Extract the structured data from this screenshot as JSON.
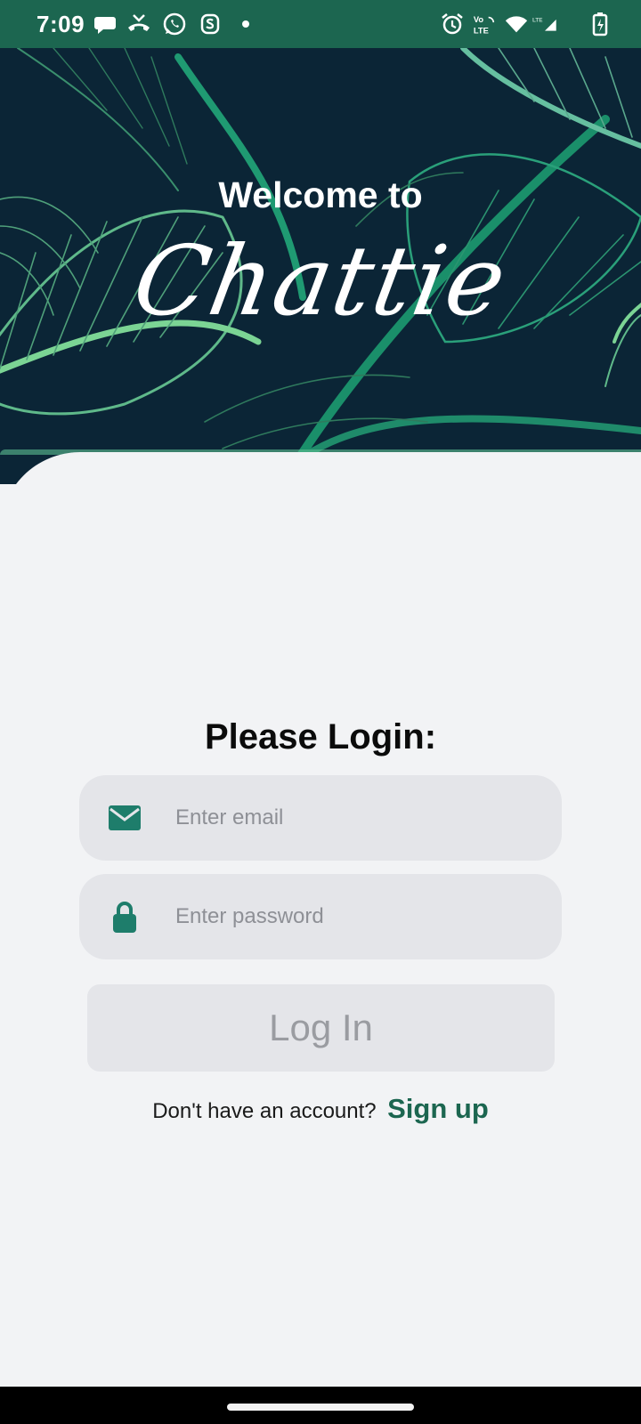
{
  "status_bar": {
    "time": "7:09",
    "left_icons": [
      "chat-bubble-icon",
      "missed-call-icon",
      "whatsapp-icon",
      "app-s-icon",
      "dot-icon"
    ],
    "right_icons": [
      "alarm-icon",
      "volte-icon",
      "wifi-icon",
      "lte-signal-icon",
      "battery-charging-icon"
    ],
    "volte_label": "Vo LTE",
    "lte_label": "LTE"
  },
  "banner": {
    "welcome": "Welcome to",
    "brand": "Chattie"
  },
  "login": {
    "title": "Please Login:",
    "email_placeholder": "Enter email",
    "email_value": "",
    "password_placeholder": "Enter password",
    "password_value": "",
    "login_button": "Log In",
    "signup_prompt": "Don't have an account?",
    "signup_link": "Sign up"
  },
  "colors": {
    "status_bar": "#1c6650",
    "banner_bg": "#0b2536",
    "accent_green": "#1c6650",
    "icon_teal": "#1e7d6b",
    "field_bg": "#e4e5e9",
    "page_bg": "#f2f3f5"
  }
}
